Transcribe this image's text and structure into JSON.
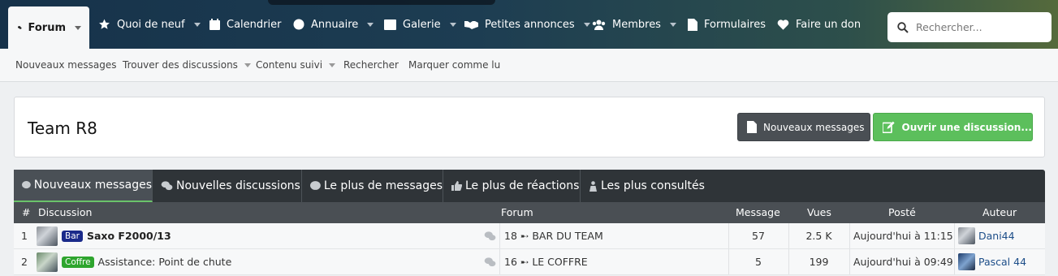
{
  "nav": {
    "items": [
      {
        "label": "Forum",
        "icon": "comments-icon"
      },
      {
        "label": "Quoi de neuf",
        "icon": "star-icon"
      },
      {
        "label": "Calendrier",
        "icon": "calendar-icon"
      },
      {
        "label": "Annuaire",
        "icon": "globe-icon"
      },
      {
        "label": "Galerie",
        "icon": "image-icon"
      },
      {
        "label": "Petites annonces",
        "icon": "handshake-icon"
      },
      {
        "label": "Membres",
        "icon": "users-icon"
      },
      {
        "label": "Formulaires",
        "icon": "file-icon"
      },
      {
        "label": "Faire un don",
        "icon": "heart-icon"
      }
    ],
    "search_placeholder": "Rechercher..."
  },
  "subnav": {
    "items": [
      "Nouveaux messages",
      "Trouver des discussions",
      "Contenu suivi",
      "Rechercher",
      "Marquer comme lu"
    ]
  },
  "header": {
    "title": "Team R8",
    "new_messages_button": "Nouveaux messages",
    "open_discussion_button": "Ouvrir une discussion..."
  },
  "tabs": [
    "Nouveaux messages",
    "Nouvelles discussions",
    "Le plus de messages",
    "Le plus de réactions",
    "Les plus consultés"
  ],
  "table": {
    "columns": [
      "#",
      "Discussion",
      "Forum",
      "Message",
      "Vues",
      "Posté",
      "Auteur"
    ],
    "rows": [
      {
        "num": "1",
        "prefix": "Bar",
        "title": "Saxo F2000/13",
        "forum": "18 ➸ BAR DU TEAM",
        "messages": "57",
        "views": "2.5 K",
        "posted": "Aujourd'hui à 11:15",
        "author": "Dani44"
      },
      {
        "num": "2",
        "prefix": "Coffre",
        "title": "Assistance: Point de chute",
        "forum": "16 ➸ LE COFFRE",
        "messages": "5",
        "views": "199",
        "posted": "Aujourd'hui à 09:49",
        "author": "Pascal 44"
      }
    ]
  },
  "colors": {
    "accent_green": "#5cbf5c",
    "nav_bg": "#16324a",
    "badge_bar": "#1a2a8a",
    "badge_coffre": "#2ea52e"
  }
}
